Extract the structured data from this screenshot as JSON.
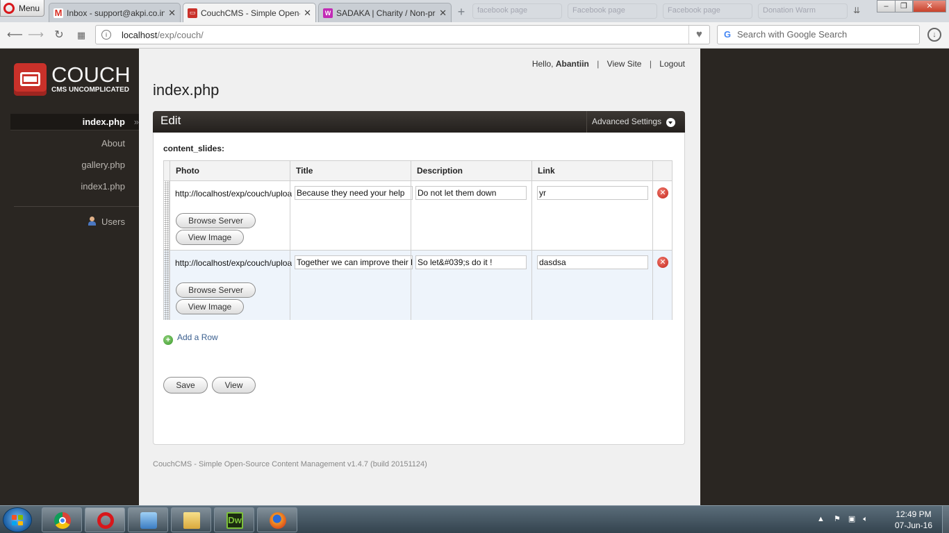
{
  "browser": {
    "menu_label": "Menu",
    "tabs": [
      {
        "label": "Inbox - support@akpi.co.in",
        "close": "✕"
      },
      {
        "label": "CouchCMS - Simple Open-Source Content Management",
        "close": "✕"
      },
      {
        "label": "SADAKA | Charity / Non-profit",
        "close": "✕"
      }
    ],
    "new_tab": "+",
    "ghost_tabs": [
      "facebook page",
      "Facebook page",
      "Facebook page",
      "Donation Warm"
    ],
    "address": {
      "host": "localhost",
      "path": "/exp/couch/"
    },
    "search_placeholder": "Search with Google Search",
    "window_controls": {
      "minimize": "–",
      "maximize": "❐",
      "close": "✕"
    }
  },
  "sidebar": {
    "logo_name": "COUCH",
    "logo_tagline": "CMS UNCOMPLICATED",
    "items": [
      {
        "label": "index.php",
        "active": true,
        "marker": "»"
      },
      {
        "label": "About"
      },
      {
        "label": "gallery.php"
      },
      {
        "label": "index1.php"
      }
    ],
    "users_label": "Users"
  },
  "header": {
    "greeting": "Hello,",
    "user": "Abantiin",
    "view_site": "View Site",
    "logout": "Logout",
    "separator": "|"
  },
  "page_title": "index.php",
  "panel": {
    "title": "Edit",
    "advanced_settings": "Advanced Settings",
    "field_label": "content_slides:",
    "columns": [
      "Photo",
      "Title",
      "Description",
      "Link"
    ],
    "rows": [
      {
        "photo": "http://localhost/exp/couch/uploads/",
        "title": "Because they need your help",
        "description": "Do not let them down",
        "link": "yr"
      },
      {
        "photo": "http://localhost/exp/couch/uploads/",
        "title": "Together we can improve their lives",
        "description": "So let&#039;s do it !",
        "link": "dasdsa"
      }
    ],
    "browse_server": "Browse Server",
    "view_image": "View Image",
    "add_row": "Add a Row",
    "save": "Save",
    "view": "View"
  },
  "footer": "CouchCMS - Simple Open-Source Content Management v1.4.7 (build 20151124)",
  "taskbar": {
    "time": "12:49 PM",
    "date": "07-Jun-16",
    "tray": "▲"
  }
}
